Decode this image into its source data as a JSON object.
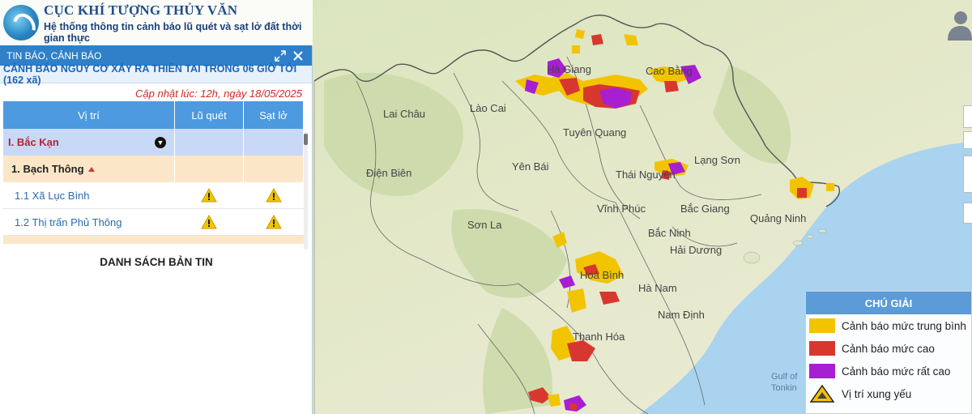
{
  "header": {
    "title": "CỤC KHÍ TƯỢNG THỦY VĂN",
    "subtitle": "Hệ thống thông tin cảnh báo lũ quét và sạt lở đất thời gian thực"
  },
  "panel": {
    "bar_title": "TIN BÁO, CẢNH BÁO",
    "warning_title": "CẢNH BÁO NGUY CƠ XẢY RA THIÊN TAI TRONG 06 GIỜ TỚI (162 xã)",
    "updated": "Cập nhật lúc: 12h, ngày 18/05/2025",
    "columns": [
      "Vị trí",
      "Lũ quét",
      "Sạt lở"
    ],
    "province": "I. Bắc Kạn",
    "district": "1. Bạch Thông",
    "communes": [
      {
        "name": "1.1  Xã Lục Bình",
        "flash_flood": true,
        "landslide": true
      },
      {
        "name": "1.2  Thị trấn Phủ Thông",
        "flash_flood": true,
        "landslide": true
      }
    ],
    "list_title": "DANH SÁCH BẢN TIN"
  },
  "legend": {
    "title": "CHÚ GIẢI",
    "items": [
      {
        "label": "Cảnh báo mức trung bình",
        "color": "#f2c400"
      },
      {
        "label": "Cảnh báo mức cao",
        "color": "#d8372f"
      },
      {
        "label": "Cảnh báo mức rất cao",
        "color": "#a71fd1"
      },
      {
        "label": "Vị trí xung yếu",
        "icon": "warning-triangle-icon"
      }
    ]
  },
  "map": {
    "places": [
      "Hà Giang",
      "Cao Bằng",
      "Lai Châu",
      "Lào Cai",
      "Tuyên Quang",
      "Lạng Sơn",
      "Điện Biên",
      "Yên Bái",
      "Thái Nguyên",
      "Vĩnh Phúc",
      "Bắc Giang",
      "Quảng Ninh",
      "Sơn La",
      "Bắc Ninh",
      "Hải Dương",
      "Hoà Bình",
      "Hà Nam",
      "Nam Định",
      "Thanh Hóa"
    ],
    "sea_label": [
      "Gulf of",
      "Tonkin"
    ]
  },
  "colors": {
    "accent": "#2f80c9",
    "alert": "#d02828",
    "sea": "#a9d3ee",
    "land": "#dfe7c8"
  }
}
